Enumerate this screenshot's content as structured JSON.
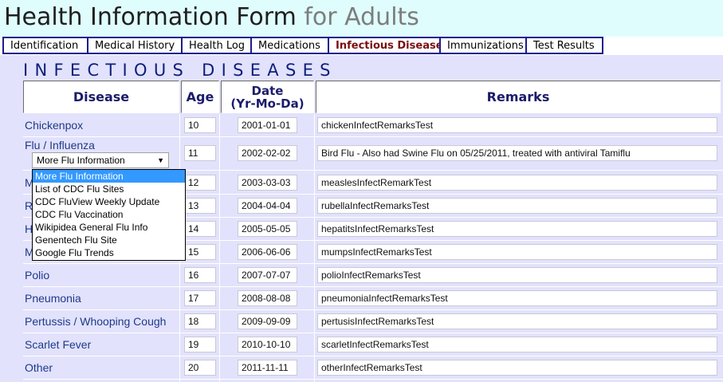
{
  "header": {
    "title_main": "Health Information Form",
    "title_sub": "for Adults"
  },
  "tabs": [
    {
      "label": "Identification"
    },
    {
      "label": "Medical History"
    },
    {
      "label": "Health Log"
    },
    {
      "label": "Medications"
    },
    {
      "label": "Infectious Diseases",
      "active": true
    },
    {
      "label": "Immunizations"
    },
    {
      "label": "Test Results"
    }
  ],
  "section_title": "INFECTIOUS DISEASES",
  "table": {
    "headers": {
      "disease": "Disease",
      "age": "Age",
      "date_line1": "Date",
      "date_line2": "(Yr-Mo-Da)",
      "remarks": "Remarks"
    },
    "rows": [
      {
        "disease": "Chickenpox",
        "age": "10",
        "date": "2001-01-01",
        "remarks": "chickenInfectRemarksTest"
      },
      {
        "disease": "Flu / Influenza",
        "age": "11",
        "date": "2002-02-02",
        "remarks": "Bird Flu - Also had Swine Flu on 05/25/2011, treated with antiviral Tamiflu"
      },
      {
        "disease": "M",
        "age": "12",
        "date": "2003-03-03",
        "remarks": "measlesInfectRemarkTest"
      },
      {
        "disease": "R",
        "age": "13",
        "date": "2004-04-04",
        "remarks": "rubellaInfectRemarksTest"
      },
      {
        "disease": "H",
        "age": "14",
        "date": "2005-05-05",
        "remarks": "hepatitsInfectRemarksTest"
      },
      {
        "disease": "M",
        "age": "15",
        "date": "2006-06-06",
        "remarks": "mumpsInfectRemarksTest"
      },
      {
        "disease": "Polio",
        "age": "16",
        "date": "2007-07-07",
        "remarks": "polioInfectRemarksTest"
      },
      {
        "disease": "Pneumonia",
        "age": "17",
        "date": "2008-08-08",
        "remarks": "pneumoniaInfectRemarksTest"
      },
      {
        "disease": "Pertussis / Whooping Cough",
        "age": "18",
        "date": "2009-09-09",
        "remarks": "pertusisInfectRemarksTest"
      },
      {
        "disease": "Scarlet Fever",
        "age": "19",
        "date": "2010-10-10",
        "remarks": "scarletInfectRemarksTest"
      },
      {
        "disease": "Other",
        "age": "20",
        "date": "2011-11-11",
        "remarks": "otherInfectRemarksTest"
      }
    ]
  },
  "flu_select": {
    "selected": "More Flu Information",
    "options": [
      "More Flu Information",
      "List of CDC Flu Sites",
      "CDC FluView Weekly Update",
      "CDC Flu Vaccination",
      "Wikipidea General Flu Info",
      "Genentech Flu Site",
      "Google Flu Trends"
    ]
  }
}
